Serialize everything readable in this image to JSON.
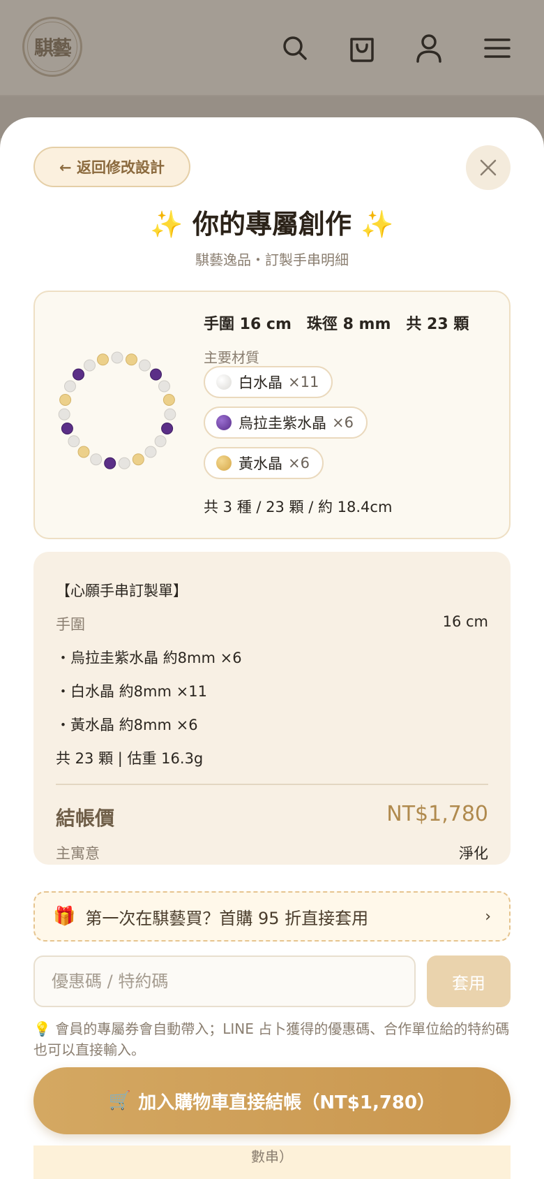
{
  "header": {
    "logo_text": "騏藝",
    "icons": [
      "search-icon",
      "shopping-bag-icon",
      "user-icon",
      "menu-icon"
    ]
  },
  "sheet": {
    "back_label": "← 返回修改設計",
    "title": "你的專屬創作",
    "title_emoji": "✨",
    "subtitle": "騏藝逸品・訂製手串明細"
  },
  "summary": {
    "wrist": "手圍 16 cm",
    "bead_size": "珠徑 8 mm",
    "count": "共 23 顆",
    "materials_label": "主要材質",
    "materials": [
      {
        "name": "白水晶",
        "qty": "×11",
        "color": "#e8e6e2"
      },
      {
        "name": "烏拉圭紫水晶",
        "qty": "×6",
        "color": "#6a3f9c"
      },
      {
        "name": "黃水晶",
        "qty": "×6",
        "color": "#e4bc64"
      }
    ],
    "total": "共 3 種 / 23 顆 / 約 18.4cm"
  },
  "order": {
    "heading": "【心願手串訂製單】",
    "wrist_label": "手圍",
    "wrist_value": "16 cm",
    "lines": [
      "・烏拉圭紫水晶 約8mm ×6",
      "・白水晶 約8mm ×11",
      "・黃水晶 約8mm ×6"
    ],
    "total": "共 23 顆 | 估重 16.3g",
    "pay_label": "結帳價",
    "pay_price": "NT$1,780",
    "meaning_label": "主寓意",
    "meaning_value": "淨化"
  },
  "promo": {
    "icon": "🎁",
    "text": "第一次在騏藝買？首購 95 折直接套用",
    "chevron": "›"
  },
  "coupon": {
    "placeholder": "優惠碼 / 特約碼",
    "apply_label": "套用"
  },
  "note": {
    "icon": "💡",
    "text": "會員的專屬券會自動帶入；LINE 占卜獲得的優惠碼、合作單位給的特約碼也可以直接輸入。"
  },
  "cta": {
    "icon": "🛒",
    "label": "加入購物車直接結帳（NT$1,780）"
  },
  "footer": {
    "text": "數串）"
  }
}
